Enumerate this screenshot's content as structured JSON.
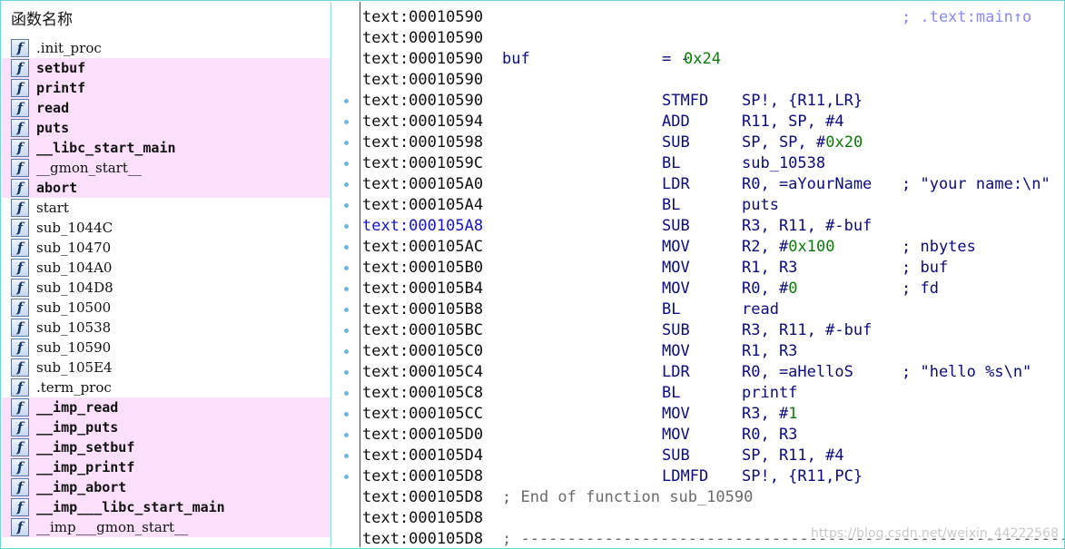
{
  "functions_panel": {
    "header": "函数名称",
    "items": [
      {
        "name": ".init_proc",
        "style": "plain"
      },
      {
        "name": "setbuf",
        "style": "lib"
      },
      {
        "name": "printf",
        "style": "lib"
      },
      {
        "name": "read",
        "style": "lib"
      },
      {
        "name": "puts",
        "style": "lib"
      },
      {
        "name": "__libc_start_main",
        "style": "lib"
      },
      {
        "name": "__gmon_start__",
        "style": "libthin"
      },
      {
        "name": "abort",
        "style": "lib"
      },
      {
        "name": "start",
        "style": "plain"
      },
      {
        "name": "sub_1044C",
        "style": "plain"
      },
      {
        "name": "sub_10470",
        "style": "plain"
      },
      {
        "name": "sub_104A0",
        "style": "plain"
      },
      {
        "name": "sub_104D8",
        "style": "plain"
      },
      {
        "name": "sub_10500",
        "style": "plain"
      },
      {
        "name": "sub_10538",
        "style": "plain"
      },
      {
        "name": "sub_10590",
        "style": "plain"
      },
      {
        "name": "sub_105E4",
        "style": "plain"
      },
      {
        "name": ".term_proc",
        "style": "plain"
      },
      {
        "name": "__imp_read",
        "style": "lib"
      },
      {
        "name": "__imp_puts",
        "style": "lib"
      },
      {
        "name": "__imp_setbuf",
        "style": "lib"
      },
      {
        "name": "__imp_printf",
        "style": "lib"
      },
      {
        "name": "__imp_abort",
        "style": "lib"
      },
      {
        "name": "__imp___libc_start_main",
        "style": "lib"
      },
      {
        "name": "__imp___gmon_start__",
        "style": "libthin"
      }
    ]
  },
  "disassembly": {
    "lines": [
      {
        "addr": "text:00010590",
        "xref": "; .text:main↑o",
        "dot": false
      },
      {
        "addr": "text:00010590",
        "dot": false
      },
      {
        "addr": "text:00010590",
        "label": "buf",
        "mnem": "= -",
        "ops_num": "0x24",
        "dot": false,
        "kind": "var"
      },
      {
        "addr": "text:00010590",
        "dot": false
      },
      {
        "addr": "text:00010590",
        "mnem": "STMFD",
        "ops": "SP!, {R11,LR}",
        "dot": true
      },
      {
        "addr": "text:00010594",
        "mnem": "ADD",
        "ops": "R11, SP, #4",
        "dot": true
      },
      {
        "addr": "text:00010598",
        "mnem": "SUB",
        "ops": "SP, SP, #",
        "ops_num": "0x20",
        "dot": true
      },
      {
        "addr": "text:0001059C",
        "mnem": "BL",
        "ops": "sub_10538",
        "dot": true
      },
      {
        "addr": "text:000105A0",
        "mnem": "LDR",
        "ops": "R0, =aYourName",
        "cmt": "; \"your name:\\n\"",
        "dot": true
      },
      {
        "addr": "text:000105A4",
        "mnem": "BL",
        "ops": "puts",
        "dot": true
      },
      {
        "addr": "text:000105A8",
        "mnem": "SUB",
        "ops": "R3, R11, #-buf",
        "dot": true,
        "hl": true
      },
      {
        "addr": "text:000105AC",
        "mnem": "MOV",
        "ops": "R2, #",
        "ops_num": "0x100",
        "cmt": "; nbytes",
        "dot": true
      },
      {
        "addr": "text:000105B0",
        "mnem": "MOV",
        "ops": "R1, R3",
        "cmt": "; buf",
        "dot": true
      },
      {
        "addr": "text:000105B4",
        "mnem": "MOV",
        "ops": "R0, #",
        "ops_num": "0",
        "cmt": "; fd",
        "dot": true
      },
      {
        "addr": "text:000105B8",
        "mnem": "BL",
        "ops": "read",
        "dot": true
      },
      {
        "addr": "text:000105BC",
        "mnem": "SUB",
        "ops": "R3, R11, #-buf",
        "dot": true
      },
      {
        "addr": "text:000105C0",
        "mnem": "MOV",
        "ops": "R1, R3",
        "dot": true
      },
      {
        "addr": "text:000105C4",
        "mnem": "LDR",
        "ops": "R0, =aHelloS",
        "cmt": "; \"hello %s\\n\"",
        "dot": true
      },
      {
        "addr": "text:000105C8",
        "mnem": "BL",
        "ops": "printf",
        "dot": true
      },
      {
        "addr": "text:000105CC",
        "mnem": "MOV",
        "ops": "R3, #",
        "ops_num": "1",
        "dot": true
      },
      {
        "addr": "text:000105D0",
        "mnem": "MOV",
        "ops": "R0, R3",
        "dot": true
      },
      {
        "addr": "text:000105D4",
        "mnem": "SUB",
        "ops": "SP, R11, #4",
        "dot": true
      },
      {
        "addr": "text:000105D8",
        "mnem": "LDMFD",
        "ops": "SP!, {R11,PC}",
        "dot": true
      },
      {
        "addr": "text:000105D8",
        "fnend": "; End of function sub_10590",
        "dot": false
      },
      {
        "addr": "text:000105D8",
        "dot": false
      },
      {
        "addr": "text:000105D8",
        "fnend": "; ---------------------------------------------------------------",
        "dot": false
      }
    ]
  },
  "watermark": "https://blog.csdn.net/weixin_44222568"
}
